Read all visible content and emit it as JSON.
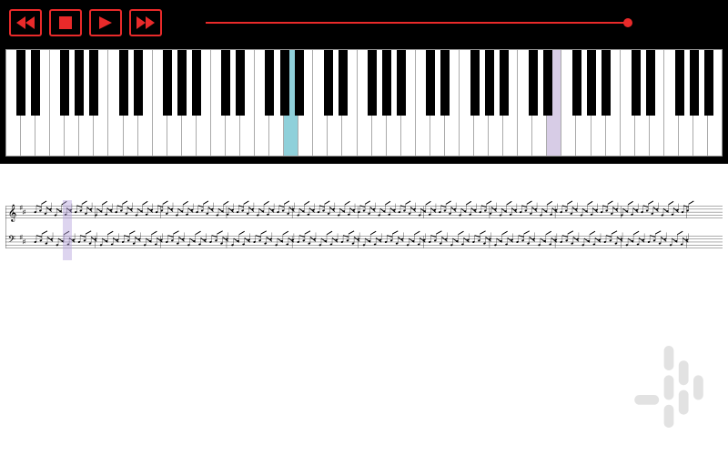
{
  "controls": {
    "rewind_label": "Rewind",
    "stop_label": "Stop",
    "play_label": "Play",
    "forward_label": "Fast Forward"
  },
  "progress": {
    "position_percent": 100
  },
  "keyboard": {
    "white_key_count": 49,
    "highlighted": [
      {
        "index": 19,
        "color": "blue"
      },
      {
        "index": 37,
        "color": "violet"
      }
    ],
    "black_key_pattern_per_7": [
      1,
      2,
      4,
      5,
      6
    ]
  },
  "sheet_music": {
    "key_signature": "D major",
    "time_signature": "common",
    "staves": 2,
    "clefs": [
      "treble",
      "bass"
    ],
    "cursor_position_percent": 8
  },
  "branding": {
    "watermark_name": "app-logo"
  }
}
